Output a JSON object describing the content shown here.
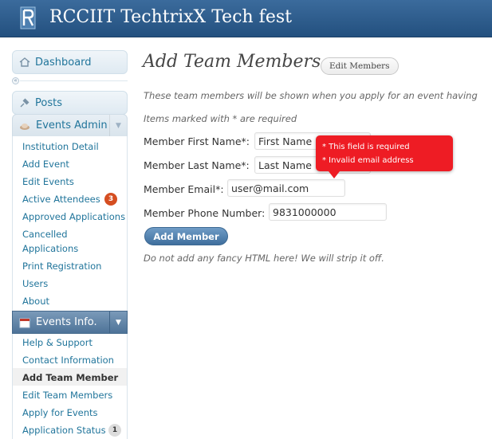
{
  "header": {
    "site_title": "RCCIIT TechtrixX Tech fest"
  },
  "sidebar": {
    "dashboard": "Dashboard",
    "posts": "Posts",
    "events_admin": {
      "label": "Events Admin",
      "items": [
        "Institution Detail",
        "Add Event",
        "Edit Events",
        "Active Attendees",
        "Approved Applications",
        "Cancelled",
        "Applications",
        "Print Registration",
        "Users",
        "About"
      ],
      "active_attendees_count": "3"
    },
    "events_info": {
      "label": "Events Info.",
      "items": [
        "Help & Support",
        "Contact Information",
        "Add Team Member",
        "Edit Team Members",
        "Apply for Events",
        "Application Status"
      ],
      "current": "Add Team Member",
      "application_status_count": "1"
    }
  },
  "main": {
    "title": "Add Team Members",
    "title_button": "Edit Members",
    "intro": "These team members will be shown when you apply for an event having",
    "required_note": "Items marked with * are required",
    "fields": {
      "first_name": {
        "label": "Member First Name*:",
        "value": "First Name"
      },
      "last_name": {
        "label": "Member Last Name*:",
        "value": "Last Name"
      },
      "email": {
        "label": "Member Email*:",
        "value": "user@mail.com"
      },
      "phone": {
        "label": "Member Phone Number:",
        "value": "9831000000"
      }
    },
    "submit_label": "Add Member",
    "footer_note": "Do not add any fancy HTML here! We will strip it off.",
    "error_tooltip": {
      "line1": "* This field is required",
      "line2": "* Invalid email address",
      "color": "#ee1c24"
    }
  },
  "colors": {
    "header_bg": "#2b5b8c",
    "link": "#21759b",
    "badge_red": "#d54e21"
  }
}
